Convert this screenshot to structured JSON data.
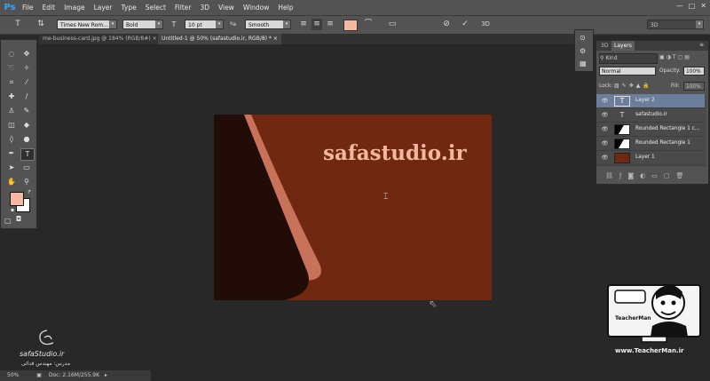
{
  "app": {
    "logo": "Ps",
    "menu": [
      "File",
      "Edit",
      "Image",
      "Layer",
      "Type",
      "Select",
      "Filter",
      "3D",
      "View",
      "Window",
      "Help"
    ],
    "window_controls": [
      "minimize-icon",
      "maximize-icon",
      "close-icon"
    ]
  },
  "options_bar": {
    "font_family": "Times New Rom...",
    "font_style": "Bold",
    "font_size": "10 pt",
    "aa_label": "ªa",
    "antialias": "Smooth",
    "workspace": "3D",
    "text_color": "#f6b8a2"
  },
  "tabs": [
    {
      "label": "me-business-card.jpg @ 184% (RGB/8#)",
      "active": false
    },
    {
      "label": "Untitled-1 @ 50% (safastudio.ir, RGB/8) *",
      "active": true
    }
  ],
  "canvas": {
    "title": "safastudio.ir",
    "colors": {
      "background": "#702910",
      "dark": "#210c08",
      "stripe": "#c8725a",
      "title": "#f3b7a0"
    }
  },
  "layers_panel": {
    "tabs": [
      "3D",
      "Layers"
    ],
    "filter": "Kind",
    "blend_mode": "Normal",
    "opacity_label": "Opacity:",
    "opacity": "100%",
    "lock_label": "Lock:",
    "fill_label": "Fill:",
    "fill": "100%",
    "layers": [
      {
        "name": "Layer 2",
        "type": "text",
        "selected": true
      },
      {
        "name": "safastudio.ir",
        "type": "text",
        "selected": false
      },
      {
        "name": "Rounded Rectangle 1 c...",
        "type": "shape",
        "selected": false
      },
      {
        "name": "Rounded Rectangle 1",
        "type": "shape",
        "selected": false
      },
      {
        "name": "Layer 1",
        "type": "fill",
        "selected": false
      }
    ]
  },
  "status": {
    "zoom": "50%",
    "doc": "Doc: 2.16M/255.9K"
  },
  "watermarks": {
    "left_site": "safaStudio.ir",
    "left_author": "مدرس: مهندس فدائی",
    "right_site": "www.TeacherMan.ir",
    "right_logo": "TeacherMan"
  }
}
